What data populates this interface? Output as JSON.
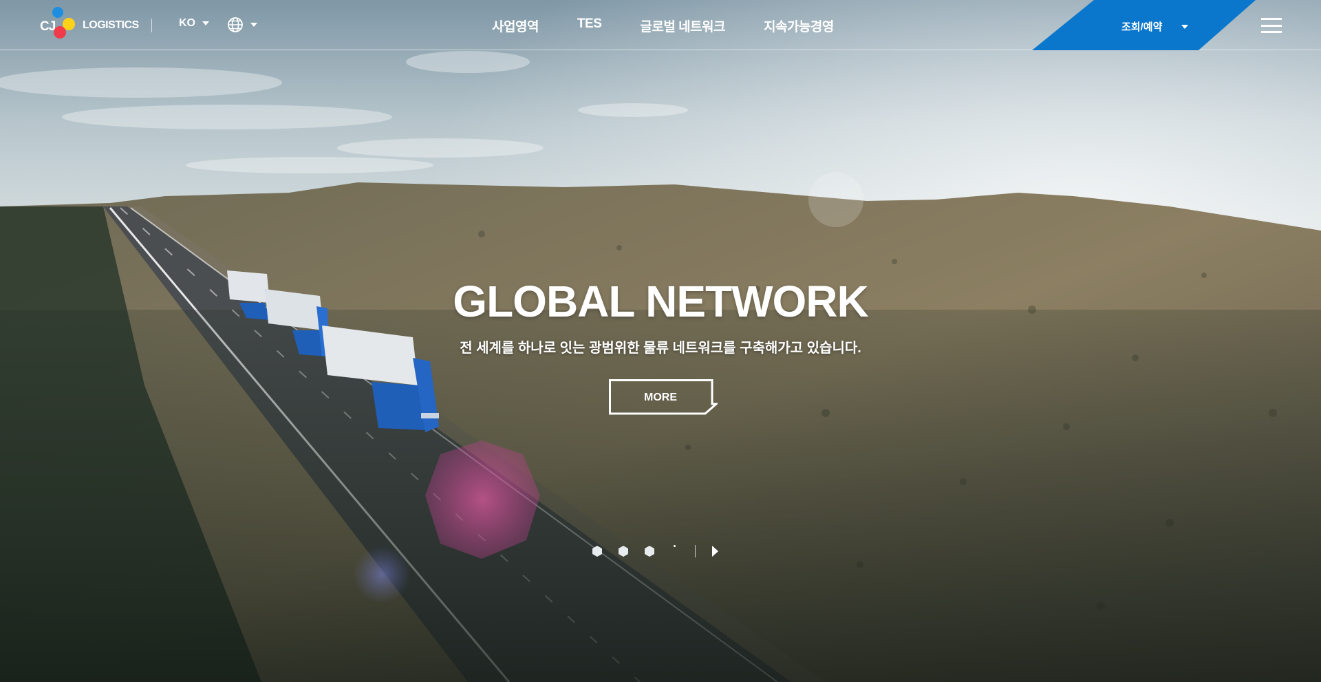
{
  "header": {
    "logo_text": "LOGISTICS",
    "logo_mark": "CJ",
    "language": "KO",
    "globe_icon": "globe-icon",
    "nav": [
      {
        "label": "사업영역"
      },
      {
        "label": "TES"
      },
      {
        "label": "글로벌 네트워크"
      },
      {
        "label": "지속가능경영"
      }
    ],
    "reserve_label": "조회/예약",
    "menu_icon": "hamburger-icon"
  },
  "hero": {
    "title": "GLOBAL NETWORK",
    "subtitle": "전 세계를 하나로 잇는 광범위한 물류 네트워크를 구축해가고 있습니다.",
    "more_label": "MORE"
  },
  "pager": {
    "slides": 4,
    "active_index": 3,
    "play_icon": "play-icon"
  },
  "colors": {
    "accent_blue": "#0a77cc",
    "logo_blue": "#1e8fe0",
    "logo_yellow": "#ffd21a",
    "logo_red": "#ef3b4a"
  }
}
